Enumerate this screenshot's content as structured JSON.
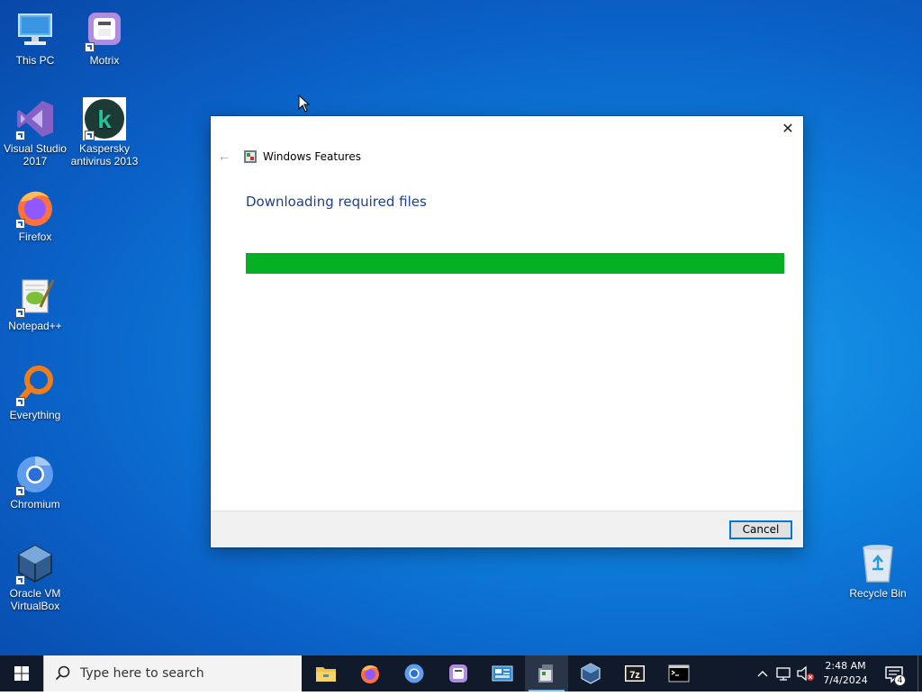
{
  "desktop": {
    "icons": [
      {
        "label": "This PC"
      },
      {
        "label": "Motrix"
      },
      {
        "label": "Visual Studio 2017"
      },
      {
        "label": "Kaspersky antivirus 2013"
      },
      {
        "label": "Firefox"
      },
      {
        "label": "Notepad++"
      },
      {
        "label": "Everything"
      },
      {
        "label": "Chromium"
      },
      {
        "label": "Oracle VM VirtualBox"
      },
      {
        "label": "Recycle Bin"
      }
    ]
  },
  "dialog": {
    "title": "Windows Features",
    "heading": "Downloading required files",
    "progress_percent": 100,
    "progress_color": "#06b025",
    "cancel_label": "Cancel",
    "close_glyph": "✕",
    "back_glyph": "←"
  },
  "taskbar": {
    "search_placeholder": "Type here to search",
    "apps": [
      {
        "name": "file-explorer-icon"
      },
      {
        "name": "firefox-icon"
      },
      {
        "name": "chromium-icon"
      },
      {
        "name": "motrix-icon"
      },
      {
        "name": "control-panel-icon"
      },
      {
        "name": "windows-features-icon"
      },
      {
        "name": "virtualbox-icon"
      },
      {
        "name": "7zip-icon"
      },
      {
        "name": "terminal-icon"
      }
    ],
    "clock_time": "2:48 AM",
    "clock_date": "7/4/2024",
    "notification_count": "4"
  },
  "colors": {
    "accent": "#0078d7",
    "heading": "#1e3f8f",
    "taskbar": "#101a2b"
  }
}
